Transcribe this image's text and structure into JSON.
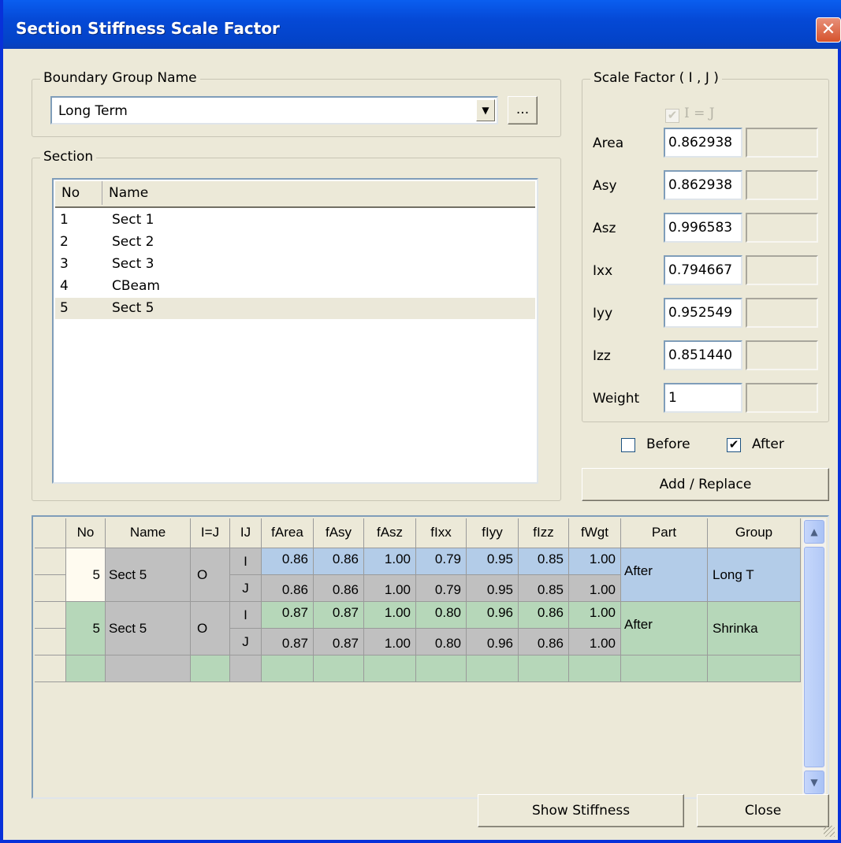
{
  "window": {
    "title": "Section Stiffness Scale Factor",
    "close_glyph": "✕"
  },
  "boundary_group": {
    "label": "Boundary Group Name",
    "value": "Long Term",
    "browse_label": "..."
  },
  "section": {
    "label": "Section",
    "columns": [
      "No",
      "Name"
    ],
    "rows": [
      {
        "no": "1",
        "name": "Sect 1"
      },
      {
        "no": "2",
        "name": "Sect 2"
      },
      {
        "no": "3",
        "name": "Sect 3"
      },
      {
        "no": "4",
        "name": "CBeam"
      },
      {
        "no": "5",
        "name": "Sect 5"
      }
    ],
    "selected_index": 4
  },
  "scale_factor": {
    "label": "Scale Factor ( I , J )",
    "ieqj_label": "I = J",
    "ieqj_checked": true,
    "fields": [
      {
        "label": "Area",
        "value": "0.862938"
      },
      {
        "label": "Asy",
        "value": "0.862938"
      },
      {
        "label": "Asz",
        "value": "0.996583"
      },
      {
        "label": "Ixx",
        "value": "0.794667"
      },
      {
        "label": "Iyy",
        "value": "0.952549"
      },
      {
        "label": "Izz",
        "value": "0.851440"
      },
      {
        "label": "Weight",
        "value": "1"
      }
    ]
  },
  "options": {
    "before_label": "Before",
    "before_checked": false,
    "after_label": "After",
    "after_checked": true,
    "add_replace_label": "Add / Replace"
  },
  "grid": {
    "headers": [
      "No",
      "Name",
      "I=J",
      "IJ",
      "fArea",
      "fAsy",
      "fAsz",
      "fIxx",
      "fIyy",
      "fIzz",
      "fWgt",
      "Part",
      "Group"
    ],
    "records": [
      {
        "no": "5",
        "name": "Sect 5",
        "ieqj": "O",
        "part": "After",
        "group": "Long T",
        "color": "#b3cce8",
        "i": [
          "0.86",
          "0.86",
          "1.00",
          "0.79",
          "0.95",
          "0.85",
          "1.00"
        ],
        "j": [
          "0.86",
          "0.86",
          "1.00",
          "0.79",
          "0.95",
          "0.85",
          "1.00"
        ]
      },
      {
        "no": "5",
        "name": "Sect 5",
        "ieqj": "O",
        "part": "After",
        "group": "Shrinka",
        "color": "#b6d7b9",
        "i": [
          "0.87",
          "0.87",
          "1.00",
          "0.80",
          "0.96",
          "0.86",
          "1.00"
        ],
        "j": [
          "0.87",
          "0.87",
          "1.00",
          "0.80",
          "0.96",
          "0.86",
          "1.00"
        ]
      }
    ],
    "i_label": "I",
    "j_label": "J"
  },
  "footer": {
    "show_stiffness_label": "Show Stiffness",
    "close_label": "Close"
  }
}
